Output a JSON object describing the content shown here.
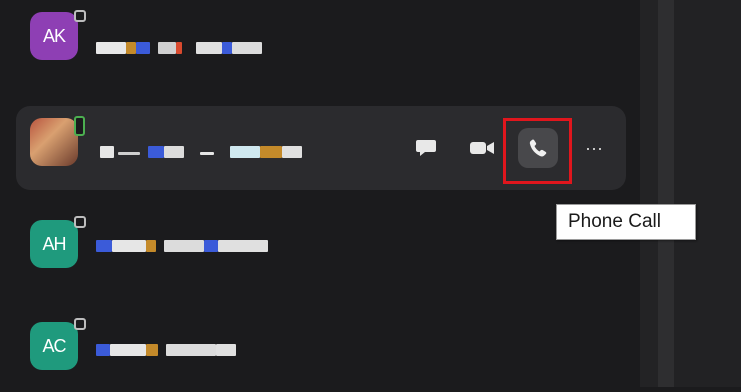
{
  "contacts": [
    {
      "initials": "AK",
      "color": "#8e3fb4",
      "status": "away"
    },
    {
      "initials": "",
      "color": "#7a4a3a",
      "status": "available",
      "hovered": true
    },
    {
      "initials": "AH",
      "color": "#1f9a7d",
      "status": "away"
    },
    {
      "initials": "AC",
      "color": "#1f9a7d",
      "status": "away"
    }
  ],
  "actions": {
    "chat_icon": "chat-bubble-icon",
    "video_icon": "video-camera-icon",
    "phone_icon": "phone-icon",
    "more_label": "···"
  },
  "tooltip": {
    "text": "Phone Call"
  },
  "highlight_color": "#e0161d"
}
